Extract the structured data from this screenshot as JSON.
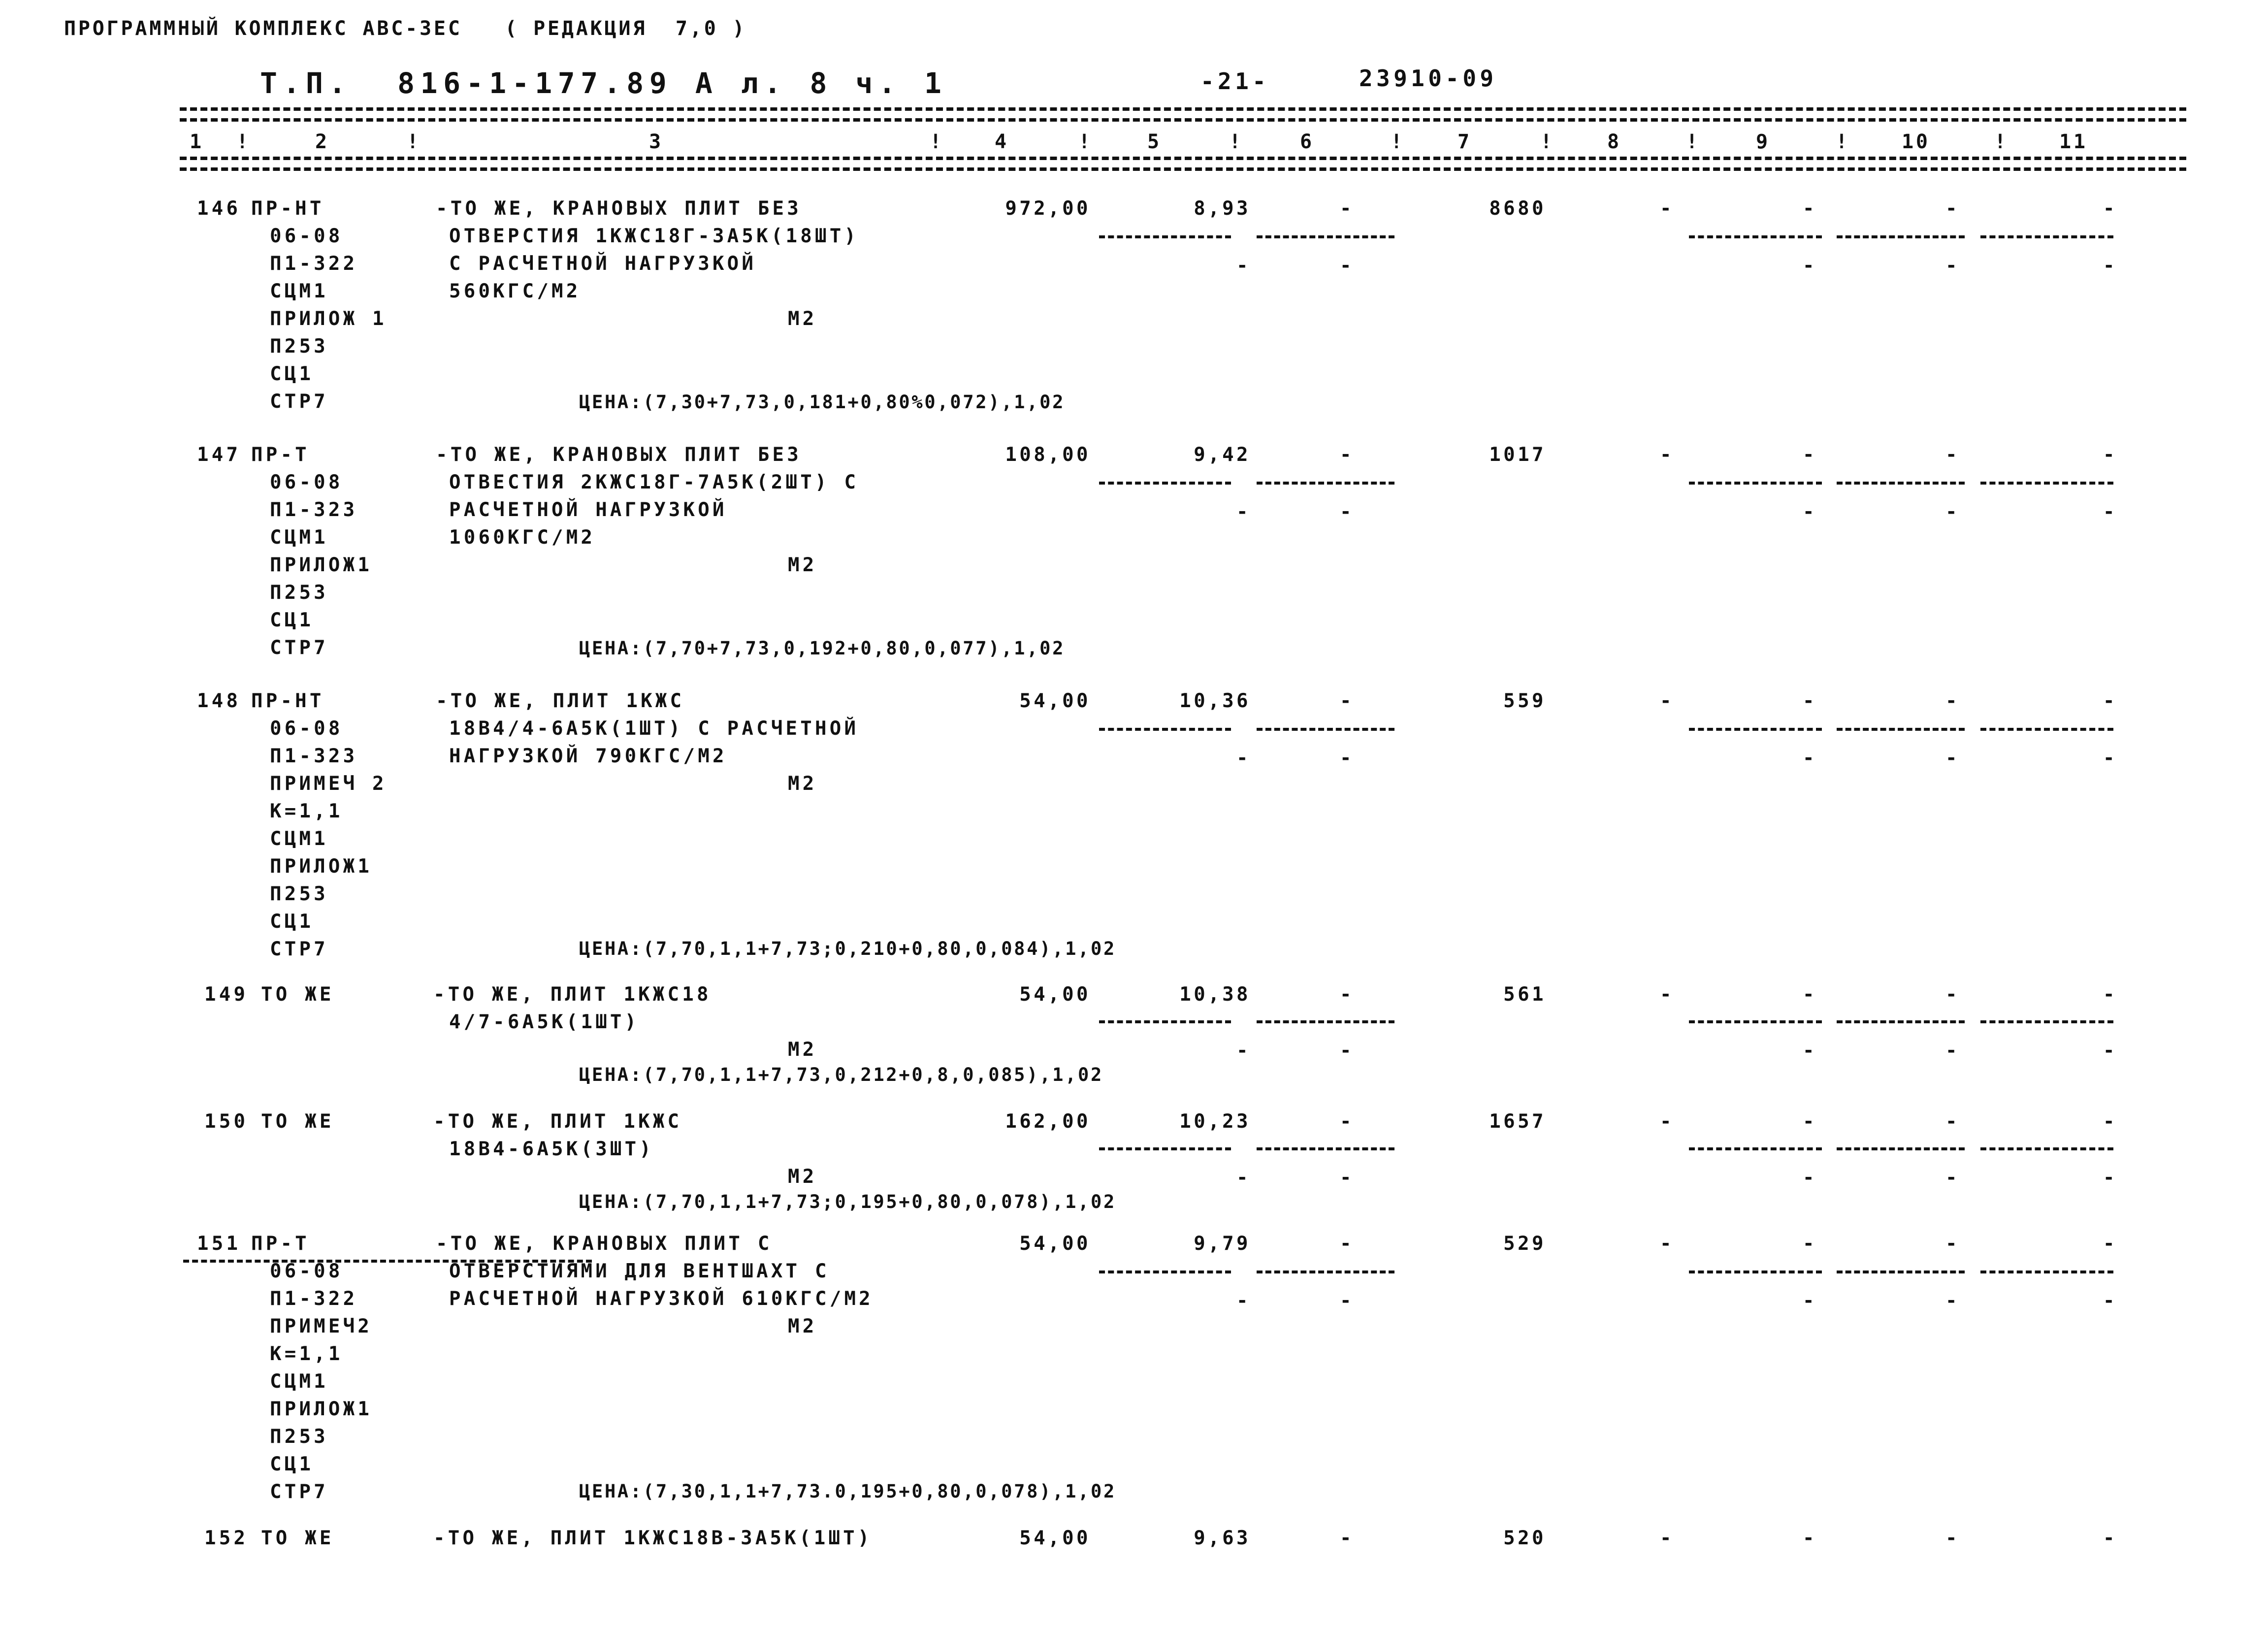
{
  "header": {
    "program_line": "ПРОГРАММНЫЙ КОМПЛЕКС АВС-3ЕС   ( РЕДАКЦИЯ  7,0 )",
    "doc_title": "Т.П.  816-1-177.89 А л. 8 ч. 1",
    "page_number": "-21-",
    "doc_code": "23910-09"
  },
  "columns": {
    "numbers": [
      "1",
      "2",
      "3",
      "4",
      "5",
      "6",
      "7",
      "8",
      "9",
      "10",
      "11"
    ],
    "separator": "!"
  },
  "units": {
    "m2": "М2",
    "dash": "-"
  },
  "rows": [
    {
      "num": "146",
      "type": "ПР-НТ",
      "codes": [
        "06-08",
        "П1-322",
        "СЦМ1",
        "ПРИЛОЖ 1",
        "П253",
        "СЦ1",
        "СТР7"
      ],
      "desc": [
        "-ТО ЖЕ, КРАНОВЫХ ПЛИТ БЕЗ",
        "ОТВЕРСТИЯ 1КЖС18Г-ЗА5К(18ШТ)",
        "С РАСЧЕТНОЙ НАГРУЗКОЙ",
        "560КГС/М2"
      ],
      "unit": "М2",
      "qty": "972,00",
      "price": "8,93",
      "col6": "-",
      "total": "8680",
      "col8": "-",
      "col9": "-",
      "col10": "-",
      "col11": "-",
      "sub": {
        "col5": "-",
        "col6": "-",
        "col9": "-",
        "col10": "-",
        "col11": "-"
      },
      "tsena": "ЦЕНА:(7,30+7,73,0,181+0,80%0,072),1,02"
    },
    {
      "num": "147",
      "type": "ПР-Т",
      "codes": [
        "06-08",
        "П1-323",
        "СЦМ1",
        "ПРИЛОЖ1",
        "П253",
        "СЦ1",
        "СТР7"
      ],
      "desc": [
        "-ТО ЖЕ, КРАНОВЫХ ПЛИТ БЕЗ",
        "ОТВЕСТИЯ 2КЖС18Г-7А5К(2ШТ) С",
        "РАСЧЕТНОЙ НАГРУЗКОЙ",
        "1060КГС/М2"
      ],
      "unit": "М2",
      "qty": "108,00",
      "price": "9,42",
      "col6": "-",
      "total": "1017",
      "col8": "-",
      "col9": "-",
      "col10": "-",
      "col11": "-",
      "sub": {
        "col5": "-",
        "col6": "-",
        "col9": "-",
        "col10": "-",
        "col11": "-"
      },
      "tsena": "ЦЕНА:(7,70+7,73,0,192+0,80,0,077),1,02"
    },
    {
      "num": "148",
      "type": "ПР-НТ",
      "codes": [
        "06-08",
        "П1-323",
        "ПРИМЕЧ 2",
        "К=1,1",
        "СЦМ1",
        "ПРИЛОЖ1",
        "П253",
        "СЦ1",
        "СТР7"
      ],
      "desc": [
        "-ТО ЖЕ, ПЛИТ 1КЖС",
        "18В4/4-6А5К(1ШТ) С РАСЧЕТНОЙ",
        "НАГРУЗКОЙ 790КГС/М2"
      ],
      "unit": "М2",
      "qty": "54,00",
      "price": "10,36",
      "col6": "-",
      "total": "559",
      "col8": "-",
      "col9": "-",
      "col10": "-",
      "col11": "-",
      "sub": {
        "col5": "-",
        "col6": "-",
        "col9": "-",
        "col10": "-",
        "col11": "-"
      },
      "tsena": "ЦЕНА:(7,70,1,1+7,73;0,210+0,80,0,084),1,02"
    },
    {
      "num": "149",
      "type": "ТО ЖЕ",
      "codes": [],
      "desc": [
        "-ТО ЖЕ, ПЛИТ 1КЖС18",
        "4/7-6А5К(1ШТ)"
      ],
      "unit": "М2",
      "qty": "54,00",
      "price": "10,38",
      "col6": "-",
      "total": "561",
      "col8": "-",
      "col9": "-",
      "col10": "-",
      "col11": "-",
      "sub": {
        "col5": "-",
        "col6": "-",
        "col9": "-",
        "col10": "-",
        "col11": "-"
      },
      "tsena": "ЦЕНА:(7,70,1,1+7,73,0,212+0,8,0,085),1,02"
    },
    {
      "num": "150",
      "type": "ТО ЖЕ",
      "codes": [],
      "desc": [
        "-ТО ЖЕ, ПЛИТ 1КЖС",
        "18В4-6А5К(3ШТ)"
      ],
      "unit": "М2",
      "qty": "162,00",
      "price": "10,23",
      "col6": "-",
      "total": "1657",
      "col8": "-",
      "col9": "-",
      "col10": "-",
      "col11": "-",
      "sub": {
        "col5": "-",
        "col6": "-",
        "col9": "-",
        "col10": "-",
        "col11": "-"
      },
      "tsena": "ЦЕНА:(7,70,1,1+7,73;0,195+0,80,0,078),1,02"
    },
    {
      "num": "151",
      "type": "ПР-Т",
      "codes": [
        "06-08",
        "П1-322",
        "ПРИМЕЧ2",
        "К=1,1",
        "СЦМ1",
        "ПРИЛОЖ1",
        "П253",
        "СЦ1",
        "СТР7"
      ],
      "desc": [
        "-ТО ЖЕ, КРАНОВЫХ ПЛИТ С",
        "ОТВЕРСТИЯМИ ДЛЯ ВЕНТШАХТ С",
        "РАСЧЕТНОЙ НАГРУЗКОЙ 610КГС/М2"
      ],
      "unit": "М2",
      "qty": "54,00",
      "price": "9,79",
      "col6": "-",
      "total": "529",
      "col8": "-",
      "col9": "-",
      "col10": "-",
      "col11": "-",
      "sub": {
        "col5": "-",
        "col6": "-",
        "col9": "-",
        "col10": "-",
        "col11": "-"
      },
      "tsena": "ЦЕНА:(7,30,1,1+7,73.0,195+0,80,0,078),1,02"
    },
    {
      "num": "152",
      "type": "ТО ЖЕ",
      "codes": [],
      "desc": [
        "-ТО ЖЕ, ПЛИТ 1КЖС18В-ЗА5К(1ШТ)"
      ],
      "unit": "",
      "qty": "54,00",
      "price": "9,63",
      "col6": "-",
      "total": "520",
      "col8": "-",
      "col9": "-",
      "col10": "-",
      "col11": "-",
      "sub": {},
      "tsena": ""
    }
  ]
}
